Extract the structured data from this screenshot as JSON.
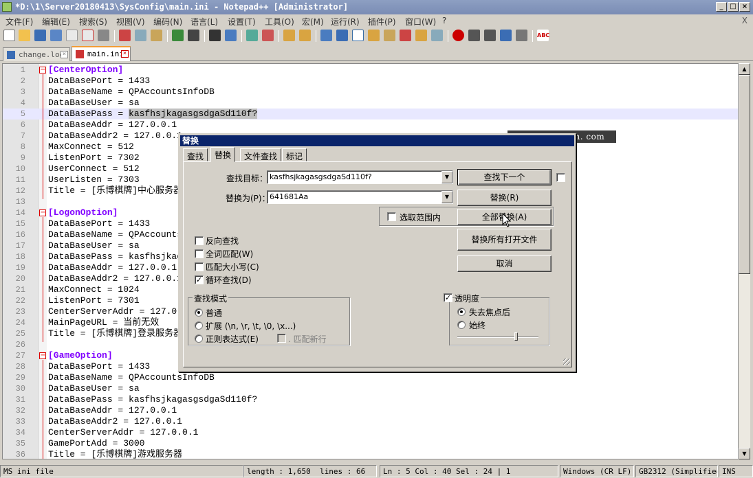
{
  "window": {
    "title": "*D:\\1\\Server20180413\\SysConfig\\main.ini - Notepad++ [Administrator]",
    "min": "_",
    "max": "□",
    "close": "×"
  },
  "menu": [
    "文件(F)",
    "编辑(E)",
    "搜索(S)",
    "视图(V)",
    "编码(N)",
    "语言(L)",
    "设置(T)",
    "工具(O)",
    "宏(M)",
    "运行(R)",
    "插件(P)",
    "窗口(W)",
    "?"
  ],
  "menu_close": "X",
  "tabs": [
    {
      "label": "change.log",
      "active": false,
      "close": "×"
    },
    {
      "label": "main.ini",
      "active": true,
      "close": "×"
    }
  ],
  "lines": [
    {
      "n": "1",
      "text": "[CenterOption]",
      "section": true
    },
    {
      "n": "2",
      "text": "DataBasePort = 1433"
    },
    {
      "n": "3",
      "text": "DataBaseName = QPAccountsInfoDB"
    },
    {
      "n": "4",
      "text": "DataBaseUser = sa"
    },
    {
      "n": "5",
      "text": "DataBasePass = ",
      "sel": "kasfhsjkagasgsdgaSd110f?",
      "current": true
    },
    {
      "n": "6",
      "text": "DataBaseAddr = 127.0.0.1"
    },
    {
      "n": "7",
      "text": "DataBaseAddr2 = 127.0.0.1"
    },
    {
      "n": "8",
      "text": "MaxConnect = 512"
    },
    {
      "n": "9",
      "text": "ListenPort = 7302"
    },
    {
      "n": "10",
      "text": "UserConnect = 512"
    },
    {
      "n": "11",
      "text": "UserListen = 7303"
    },
    {
      "n": "12",
      "text": "Title = [乐博棋牌]中心服务器"
    },
    {
      "n": "13",
      "text": ""
    },
    {
      "n": "14",
      "text": "[LogonOption]",
      "section": true
    },
    {
      "n": "15",
      "text": "DataBasePort = 1433"
    },
    {
      "n": "16",
      "text": "DataBaseName = QPAccountsInfoDB"
    },
    {
      "n": "17",
      "text": "DataBaseUser = sa"
    },
    {
      "n": "18",
      "text": "DataBasePass = kasfhsjkagasgsdgaSd110f?"
    },
    {
      "n": "19",
      "text": "DataBaseAddr = 127.0.0.1"
    },
    {
      "n": "20",
      "text": "DataBaseAddr2 = 127.0.0.1"
    },
    {
      "n": "21",
      "text": "MaxConnect = 1024"
    },
    {
      "n": "22",
      "text": "ListenPort = 7301"
    },
    {
      "n": "23",
      "text": "CenterServerAddr = 127.0.0.1"
    },
    {
      "n": "24",
      "text": "MainPageURL = 当前无效"
    },
    {
      "n": "25",
      "text": "Title = [乐博棋牌]登录服务器"
    },
    {
      "n": "26",
      "text": ""
    },
    {
      "n": "27",
      "text": "[GameOption]",
      "section": true
    },
    {
      "n": "28",
      "text": "DataBasePort = 1433"
    },
    {
      "n": "29",
      "text": "DataBaseName = QPAccountsInfoDB"
    },
    {
      "n": "30",
      "text": "DataBaseUser = sa"
    },
    {
      "n": "31",
      "text": "DataBasePass = kasfhsjkagasgsdgaSd110f?"
    },
    {
      "n": "32",
      "text": "DataBaseAddr = 127.0.0.1"
    },
    {
      "n": "33",
      "text": "DataBaseAddr2 = 127.0.0.1"
    },
    {
      "n": "34",
      "text": "CenterServerAddr = 127.0.0.1"
    },
    {
      "n": "35",
      "text": "GamePortAdd = 3000"
    },
    {
      "n": "36",
      "text": "Title = [乐博棋牌]游戏服务器"
    }
  ],
  "watermark": "www. jiufuquan. com",
  "dialog": {
    "title": "替换",
    "tabs": [
      "查找",
      "替换",
      "文件查找",
      "标记"
    ],
    "find_label": "查找目标：",
    "find_value": "kasfhsjkagasgsdgaSd110f?",
    "replace_label": "替换为(P)：",
    "replace_value": "641681Aa",
    "btn_find_next": "查找下一个",
    "btn_replace": "替换(R)",
    "btn_replace_all": "全部替换(A)",
    "btn_replace_all_open": "替换所有打开文件",
    "btn_cancel": "取消",
    "in_selection": "选取范围内",
    "reverse": "反向查找",
    "whole_word": "全词匹配(W)",
    "match_case": "匹配大小写(C)",
    "wrap": "循环查找(D)",
    "mode_title": "查找模式",
    "mode_normal": "普通",
    "mode_extended": "扩展 (\\n, \\r, \\t, \\0, \\x...)",
    "mode_regex": "正则表达式(E)",
    "dot_newline": ". 匹配新行",
    "transparency": "透明度",
    "on_lose_focus": "失去焦点后",
    "always": "始终"
  },
  "status": {
    "type": "MS ini file",
    "length": "length : 1,650",
    "lines": "lines : 66",
    "pos": "Ln : 5    Col : 40    Sel : 24 | 1",
    "eol": "Windows (CR LF)",
    "enc": "GB2312 (Simplified)",
    "ins": "INS"
  }
}
